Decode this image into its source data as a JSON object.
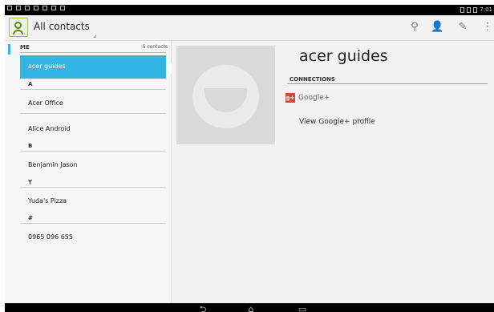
{
  "status_bar": {
    "left_icons": [
      "notification-icon",
      "menu-icon",
      "wifi-icon",
      "usb-icon",
      "warning-icon",
      "image-icon",
      "mail-icon"
    ],
    "right_icons": [
      "battery-small-icon",
      "wifi-icon",
      "battery-icon"
    ],
    "clock": "7:01"
  },
  "action_bar": {
    "title": "All contacts",
    "icons": [
      "search-icon",
      "add-contact-icon",
      "edit-icon",
      "overflow-menu-icon"
    ]
  },
  "contact_list": {
    "me_header": "ME",
    "count": "5 contacts",
    "selected_contact": "acer guides",
    "sections": [
      {
        "letter": "A",
        "contacts": [
          "Acer Office",
          "Alice Android"
        ]
      },
      {
        "letter": "B",
        "contacts": [
          "Benjamin Jason"
        ]
      },
      {
        "letter": "Y",
        "contacts": [
          "Yuda's Pizza"
        ]
      },
      {
        "letter": "#",
        "contacts": [
          "0965 096 655"
        ]
      }
    ]
  },
  "detail": {
    "name": "acer guides",
    "connections_header": "CONNECTIONS",
    "service": "Google+",
    "service_icon_text": "g+",
    "link": "View Google+ profile"
  },
  "nav_bar": {
    "buttons": [
      "back-icon",
      "home-icon",
      "recent-apps-icon"
    ],
    "glyphs": [
      "⮌",
      "⌂",
      "▭"
    ]
  },
  "colors": {
    "accent": "#33b5e5",
    "google_plus": "#d34836"
  }
}
